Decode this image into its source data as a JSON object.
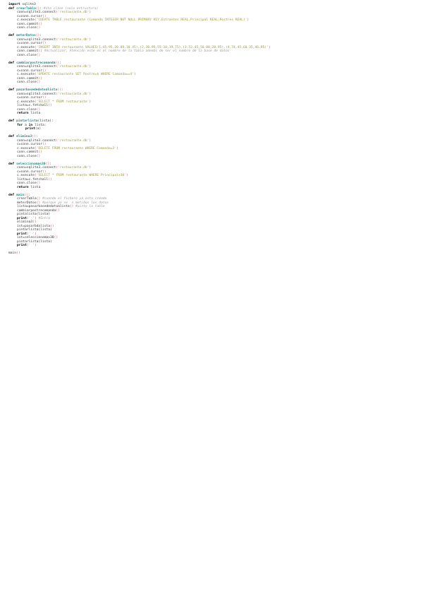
{
  "lines": [
    {
      "ind": 0,
      "parts": [
        [
          "kw",
          "import"
        ],
        [
          "t",
          " sqlite3"
        ]
      ]
    },
    {
      "ind": 0,
      "parts": [
        [
          "kw",
          "def "
        ],
        [
          "fn",
          "crearTabla"
        ],
        [
          "par",
          "()"
        ],
        [
          "t",
          ": "
        ],
        [
          "cm",
          "#sta clase (solo estructura)"
        ]
      ]
    },
    {
      "ind": 1,
      "parts": [
        [
          "t",
          "conn=sqlite3.connect"
        ],
        [
          "par",
          "("
        ],
        [
          "str",
          "'restaurante.db'"
        ],
        [
          "par",
          ")"
        ]
      ]
    },
    {
      "ind": 1,
      "parts": [
        [
          "t",
          "c=conn.cursor"
        ],
        [
          "par",
          "()"
        ]
      ]
    },
    {
      "ind": 1,
      "parts": [
        [
          "t",
          "c.execute"
        ],
        [
          "par",
          "("
        ],
        [
          "str",
          "'CREATE TABLE restaurante (Comanda INTEGER NOT NULL PRIMARY KEY,Entrantes REAL,Principal REAL,Postres REAL)'"
        ],
        [
          "par",
          ")"
        ]
      ]
    },
    {
      "ind": 1,
      "parts": [
        [
          "t",
          "conn.commit"
        ],
        [
          "par",
          "()"
        ]
      ]
    },
    {
      "ind": 1,
      "parts": [
        [
          "t",
          "conn.close"
        ],
        [
          "par",
          "()"
        ]
      ]
    },
    {
      "blank": true
    },
    {
      "ind": 0,
      "parts": [
        [
          "kw",
          "def "
        ],
        [
          "fn",
          "meterDatos"
        ],
        [
          "par",
          "()"
        ],
        [
          "t",
          ":"
        ]
      ]
    },
    {
      "ind": 1,
      "parts": [
        [
          "t",
          "conn=sqlite3.connect"
        ],
        [
          "par",
          "("
        ],
        [
          "str",
          "'restaurante.db'"
        ],
        [
          "par",
          ")"
        ]
      ]
    },
    {
      "ind": 1,
      "parts": [
        [
          "t",
          "c=conn.cursor"
        ],
        [
          "par",
          "()"
        ]
      ]
    },
    {
      "ind": 1,
      "parts": [
        [
          "t",
          "c.execute"
        ],
        [
          "par",
          "("
        ],
        [
          "str",
          "'INSERT INTO restaurante VALUES(1,45.95,20.09,10.45),(2,30.95,55.10,19.75),(3,53.45,50.00,20.95),(4,74.45,60.35,46.95)'"
        ],
        [
          "par",
          ")"
        ]
      ]
    },
    {
      "ind": 1,
      "parts": [
        [
          "t",
          "conn.commit"
        ],
        [
          "par",
          "()"
        ],
        [
          "t",
          " "
        ],
        [
          "cm",
          "#Actualizar. Atención este es el nombre de la tabla además de ser el nombre de la base de datos"
        ]
      ]
    },
    {
      "ind": 1,
      "parts": [
        [
          "t",
          "conn.close"
        ],
        [
          "par",
          "()"
        ]
      ]
    },
    {
      "blank": true
    },
    {
      "ind": 0,
      "parts": [
        [
          "kw",
          "def "
        ],
        [
          "fn",
          "cambiarpostrecomanda"
        ],
        [
          "par",
          "()"
        ],
        [
          "t",
          ":"
        ]
      ]
    },
    {
      "ind": 1,
      "parts": [
        [
          "t",
          "conn=sqlite3.connect"
        ],
        [
          "par",
          "("
        ],
        [
          "str",
          "'restaurante.db'"
        ],
        [
          "par",
          ")"
        ]
      ]
    },
    {
      "ind": 1,
      "parts": [
        [
          "t",
          "c=conn.cursor"
        ],
        [
          "par",
          "()"
        ]
      ]
    },
    {
      "ind": 1,
      "parts": [
        [
          "t",
          "c.execute"
        ],
        [
          "par",
          "("
        ],
        [
          "str",
          "'UPDATE restaurante SET Postre=$ WHERE Comanda==4'"
        ],
        [
          "par",
          ")"
        ]
      ]
    },
    {
      "ind": 1,
      "parts": [
        [
          "t",
          "conn.commit"
        ],
        [
          "par",
          "()"
        ]
      ]
    },
    {
      "ind": 1,
      "parts": [
        [
          "t",
          "conn.close"
        ],
        [
          "par",
          "()"
        ]
      ]
    },
    {
      "blank": true
    },
    {
      "ind": 0,
      "parts": [
        [
          "kw",
          "def "
        ],
        [
          "fn",
          "pasarbasededatoalista"
        ],
        [
          "par",
          "()"
        ],
        [
          "t",
          ":"
        ]
      ]
    },
    {
      "ind": 1,
      "parts": [
        [
          "t",
          "conn=sqlite3.connect"
        ],
        [
          "par",
          "("
        ],
        [
          "str",
          "'restaurante.db'"
        ],
        [
          "par",
          ")"
        ]
      ]
    },
    {
      "ind": 1,
      "parts": [
        [
          "t",
          "c=conn.cursor"
        ],
        [
          "par",
          "()"
        ]
      ]
    },
    {
      "ind": 1,
      "parts": [
        [
          "t",
          "c.execute"
        ],
        [
          "par",
          "("
        ],
        [
          "str",
          "'SELECT * FROM restaurante'"
        ],
        [
          "par",
          ")"
        ]
      ]
    },
    {
      "ind": 1,
      "parts": [
        [
          "t",
          "lista=c.fetchall"
        ],
        [
          "par",
          "()"
        ]
      ]
    },
    {
      "ind": 1,
      "parts": [
        [
          "t",
          "conn.close"
        ],
        [
          "par",
          "()"
        ]
      ]
    },
    {
      "ind": 1,
      "parts": [
        [
          "kw",
          "return"
        ],
        [
          "t",
          " lista"
        ]
      ]
    },
    {
      "blank": true
    },
    {
      "ind": 0,
      "parts": [
        [
          "kw",
          "def "
        ],
        [
          "fn",
          "pintarlista"
        ],
        [
          "t",
          "(lista):"
        ]
      ]
    },
    {
      "ind": 1,
      "parts": [
        [
          "kw",
          "for"
        ],
        [
          "t",
          " a "
        ],
        [
          "kw",
          "in"
        ],
        [
          "t",
          " lista:"
        ]
      ]
    },
    {
      "ind": 2,
      "parts": [
        [
          "kw",
          "print"
        ],
        [
          "t",
          "(a)"
        ]
      ]
    },
    {
      "blank": true
    },
    {
      "ind": 0,
      "parts": [
        [
          "kw",
          "def "
        ],
        [
          "fn",
          "elimina3"
        ],
        [
          "par",
          "()"
        ],
        [
          "t",
          ":"
        ]
      ]
    },
    {
      "ind": 1,
      "parts": [
        [
          "t",
          "conn=sqlite3.connect"
        ],
        [
          "par",
          "("
        ],
        [
          "str",
          "'restaurante.db'"
        ],
        [
          "par",
          ")"
        ]
      ]
    },
    {
      "ind": 1,
      "parts": [
        [
          "t",
          "c=conn.cursor"
        ],
        [
          "par",
          "()"
        ]
      ]
    },
    {
      "ind": 1,
      "parts": [
        [
          "t",
          "c.execute"
        ],
        [
          "par",
          "("
        ],
        [
          "str",
          "'DELETE FROM restaurante WHERE Comanda=3'"
        ],
        [
          "par",
          ")"
        ]
      ]
    },
    {
      "ind": 1,
      "parts": [
        [
          "t",
          "conn.commit"
        ],
        [
          "par",
          "()"
        ]
      ]
    },
    {
      "ind": 1,
      "parts": [
        [
          "t",
          "conn.close"
        ],
        [
          "par",
          "()"
        ]
      ]
    },
    {
      "blank": true
    },
    {
      "ind": 0,
      "parts": [
        [
          "kw",
          "def "
        ],
        [
          "fn",
          "seleccionamas30"
        ],
        [
          "par",
          "()"
        ],
        [
          "t",
          ":"
        ]
      ]
    },
    {
      "ind": 1,
      "parts": [
        [
          "t",
          "conn=sqlite3.connect"
        ],
        [
          "par",
          "("
        ],
        [
          "str",
          "'restaurante.db'"
        ],
        [
          "par",
          ")"
        ]
      ]
    },
    {
      "ind": 1,
      "parts": [
        [
          "t",
          "c=conn.cursor"
        ],
        [
          "par",
          "()"
        ]
      ]
    },
    {
      "ind": 1,
      "parts": [
        [
          "t",
          "c.execute"
        ],
        [
          "par",
          "("
        ],
        [
          "str",
          "'SELECT * FROM restaurante WHERE Principal>30'"
        ],
        [
          "par",
          ")"
        ]
      ]
    },
    {
      "ind": 1,
      "parts": [
        [
          "t",
          "lista=c.fetchall"
        ],
        [
          "par",
          "()"
        ]
      ]
    },
    {
      "ind": 1,
      "parts": [
        [
          "t",
          "conn.close"
        ],
        [
          "par",
          "()"
        ]
      ]
    },
    {
      "ind": 1,
      "parts": [
        [
          "kw",
          "return"
        ],
        [
          "t",
          " lista"
        ]
      ]
    },
    {
      "blank": true
    },
    {
      "ind": 0,
      "parts": [
        [
          "kw",
          "def "
        ],
        [
          "fn",
          "main"
        ],
        [
          "par",
          "()"
        ],
        [
          "t",
          ":"
        ]
      ]
    },
    {
      "ind": 1,
      "parts": [
        [
          "t",
          "crearTabla"
        ],
        [
          "par",
          "()"
        ],
        [
          "t",
          " "
        ],
        [
          "cm",
          "#cuando el fichero ya esta creado"
        ]
      ]
    },
    {
      "ind": 1,
      "parts": [
        [
          "t",
          "meterDatos"
        ],
        [
          "par",
          "()"
        ],
        [
          "t",
          " "
        ],
        [
          "cm",
          "#porque ya se  n metidos los datos"
        ]
      ]
    },
    {
      "ind": 1,
      "parts": [
        [
          "t",
          "lista=pasarbasededatoalista"
        ],
        [
          "par",
          "()"
        ],
        [
          "t",
          " "
        ],
        [
          "cm",
          "#pinto la tabla"
        ]
      ]
    },
    {
      "ind": 1,
      "parts": [
        [
          "t",
          "cambiarpostrecomanda"
        ],
        [
          "par",
          "()"
        ]
      ]
    },
    {
      "ind": 1,
      "parts": [
        [
          "t",
          "pintalista(lista)"
        ]
      ]
    },
    {
      "ind": 1,
      "parts": [
        [
          "kw",
          "print"
        ],
        [
          "par",
          "("
        ],
        [
          "str",
          "'-'"
        ],
        [
          "par",
          ")"
        ],
        [
          "t",
          " "
        ],
        [
          "cm",
          "#Intro"
        ]
      ]
    },
    {
      "ind": 1,
      "parts": [
        [
          "t",
          "elimina3"
        ],
        [
          "par",
          "()"
        ]
      ]
    },
    {
      "ind": 1,
      "parts": [
        [
          "t",
          "ist=pasarbdalista"
        ],
        [
          "par",
          "()"
        ]
      ]
    },
    {
      "ind": 1,
      "parts": [
        [
          "t",
          "pintarlista(lista)"
        ]
      ]
    },
    {
      "ind": 1,
      "parts": [
        [
          "kw",
          "print"
        ],
        [
          "par",
          "("
        ],
        [
          "str",
          "' '"
        ],
        [
          "par",
          ")"
        ]
      ]
    },
    {
      "ind": 1,
      "parts": [
        [
          "t",
          "ist=seleccionamas30"
        ],
        [
          "par",
          "()"
        ]
      ]
    },
    {
      "ind": 1,
      "parts": [
        [
          "t",
          "pintarlista(lista)"
        ]
      ]
    },
    {
      "ind": 1,
      "parts": [
        [
          "kw",
          "print"
        ],
        [
          "par",
          "("
        ],
        [
          "str",
          "' '"
        ],
        [
          "par",
          ")"
        ]
      ]
    },
    {
      "blank": true
    },
    {
      "ind": 0,
      "parts": [
        [
          "t",
          "main"
        ],
        [
          "par",
          "()"
        ]
      ]
    }
  ]
}
